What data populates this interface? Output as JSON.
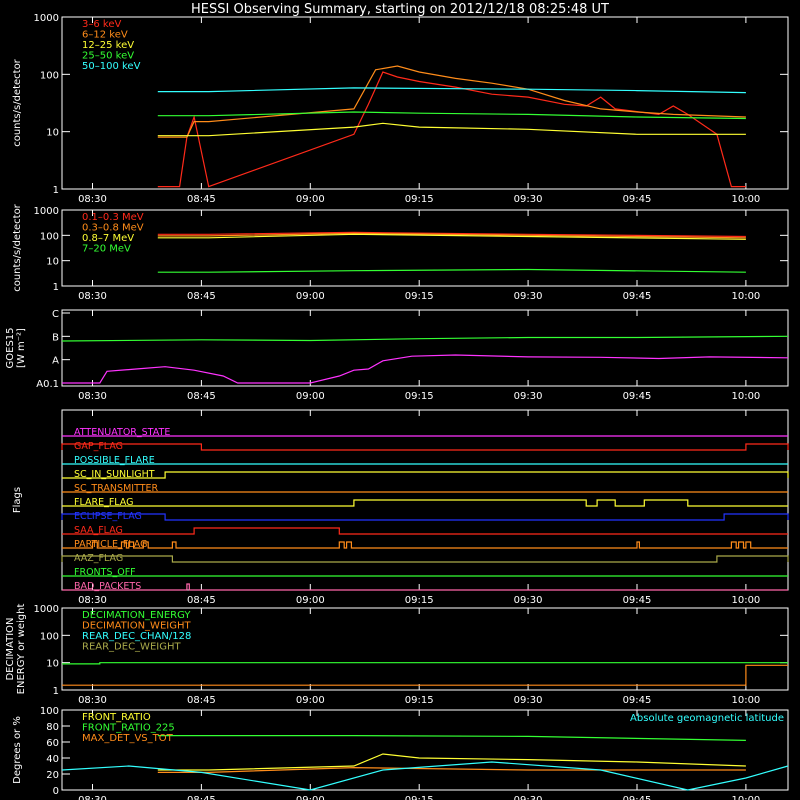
{
  "title": "HESSI Observing Summary, starting on 2012/12/18 08:25:48 UT",
  "colors": {
    "background": "#000000",
    "axes": "#ffffff",
    "red": "#ff2a1a",
    "orange": "#ff8c1a",
    "yellow": "#ffff33",
    "green": "#33ff33",
    "cyan": "#33ffff",
    "magenta": "#ff33ff",
    "blue": "#2233ff",
    "olive": "#a9a94a",
    "pink": "#ff66aa"
  },
  "time_axis": {
    "start": "08:25:48",
    "end": "10:05:48",
    "ticks": [
      "08:30",
      "08:45",
      "09:00",
      "09:15",
      "09:30",
      "09:45",
      "10:00"
    ]
  },
  "chart_data": [
    {
      "type": "line",
      "id": "hxr",
      "ylabel": "counts/s/detector",
      "yscale": "log",
      "ylim": [
        1,
        1000
      ],
      "yticks": [
        "1",
        "10",
        "100",
        "1000"
      ],
      "legend_position": "top-left",
      "series": [
        {
          "name": "3–6 keV",
          "color": "red",
          "points": [
            [
              "08:39:00",
              1.1
            ],
            [
              "08:42:00",
              1.1
            ],
            [
              "08:43:00",
              8
            ],
            [
              "08:44:00",
              18
            ],
            [
              "08:46:00",
              1.1
            ],
            [
              "09:06:00",
              9
            ],
            [
              "09:08:00",
              30
            ],
            [
              "09:10:00",
              110
            ],
            [
              "09:12:00",
              90
            ],
            [
              "09:15:00",
              75
            ],
            [
              "09:20:00",
              60
            ],
            [
              "09:25:00",
              45
            ],
            [
              "09:30:00",
              40
            ],
            [
              "09:35:00",
              30
            ],
            [
              "09:38:00",
              28
            ],
            [
              "09:40:00",
              40
            ],
            [
              "09:42:00",
              25
            ],
            [
              "09:48:00",
              20
            ],
            [
              "09:50:00",
              28
            ],
            [
              "09:52:00",
              20
            ],
            [
              "09:56:00",
              9
            ],
            [
              "09:58:00",
              1.1
            ],
            [
              "10:00:00",
              1.1
            ]
          ]
        },
        {
          "name": "6–12 keV",
          "color": "orange",
          "points": [
            [
              "08:39:00",
              8
            ],
            [
              "08:43:00",
              8
            ],
            [
              "08:44:00",
              15
            ],
            [
              "08:46:00",
              15
            ],
            [
              "09:06:00",
              25
            ],
            [
              "09:09:00",
              120
            ],
            [
              "09:12:00",
              140
            ],
            [
              "09:15:00",
              110
            ],
            [
              "09:20:00",
              85
            ],
            [
              "09:25:00",
              70
            ],
            [
              "09:30:00",
              55
            ],
            [
              "09:35:00",
              35
            ],
            [
              "09:40:00",
              25
            ],
            [
              "09:45:00",
              22
            ],
            [
              "09:50:00",
              20
            ],
            [
              "10:00:00",
              18
            ]
          ]
        },
        {
          "name": "12–25 keV",
          "color": "yellow",
          "points": [
            [
              "08:39:00",
              8.5
            ],
            [
              "08:46:00",
              8.5
            ],
            [
              "09:06:00",
              12
            ],
            [
              "09:10:00",
              14
            ],
            [
              "09:15:00",
              12
            ],
            [
              "09:30:00",
              11
            ],
            [
              "09:45:00",
              9
            ],
            [
              "10:00:00",
              9
            ]
          ]
        },
        {
          "name": "25–50 keV",
          "color": "green",
          "points": [
            [
              "08:39:00",
              19
            ],
            [
              "08:46:00",
              19
            ],
            [
              "09:06:00",
              22
            ],
            [
              "09:15:00",
              21
            ],
            [
              "09:30:00",
              20
            ],
            [
              "09:45:00",
              18
            ],
            [
              "10:00:00",
              17
            ]
          ]
        },
        {
          "name": "50–100 keV",
          "color": "cyan",
          "points": [
            [
              "08:39:00",
              50
            ],
            [
              "08:46:00",
              50
            ],
            [
              "09:06:00",
              58
            ],
            [
              "09:30:00",
              55
            ],
            [
              "09:45:00",
              52
            ],
            [
              "10:00:00",
              48
            ]
          ]
        }
      ]
    },
    {
      "type": "line",
      "id": "gamma",
      "ylabel": "counts/s/detector",
      "yscale": "log",
      "ylim": [
        1,
        1000
      ],
      "yticks": [
        "1",
        "10",
        "100",
        "1000"
      ],
      "legend_position": "top-left",
      "series": [
        {
          "name": "0.1–0.3 MeV",
          "color": "red",
          "points": [
            [
              "08:39:00",
              110
            ],
            [
              "08:46:00",
              110
            ],
            [
              "09:06:00",
              130
            ],
            [
              "09:30:00",
              110
            ],
            [
              "10:00:00",
              90
            ]
          ]
        },
        {
          "name": "0.3–0.8 MeV",
          "color": "orange",
          "points": [
            [
              "08:39:00",
              95
            ],
            [
              "08:46:00",
              95
            ],
            [
              "09:06:00",
              120
            ],
            [
              "09:30:00",
              100
            ],
            [
              "10:00:00",
              80
            ]
          ]
        },
        {
          "name": "0.8–7 MeV",
          "color": "yellow",
          "points": [
            [
              "08:39:00",
              80
            ],
            [
              "08:46:00",
              80
            ],
            [
              "09:06:00",
              110
            ],
            [
              "09:30:00",
              90
            ],
            [
              "10:00:00",
              70
            ]
          ]
        },
        {
          "name": "7–20 MeV",
          "color": "green",
          "points": [
            [
              "08:39:00",
              3.5
            ],
            [
              "08:46:00",
              3.5
            ],
            [
              "09:06:00",
              4
            ],
            [
              "09:30:00",
              4.5
            ],
            [
              "10:00:00",
              3.5
            ]
          ]
        }
      ]
    },
    {
      "type": "line",
      "id": "goes",
      "ylabel": "GOES15",
      "ylabel2": "[W m⁻²]",
      "yticks": [
        "A0.1",
        "A",
        "B",
        "C"
      ],
      "series": [
        {
          "name": "goes-long",
          "color": "green",
          "points": [
            [
              "08:25:48",
              1.8
            ],
            [
              "08:45:00",
              1.85
            ],
            [
              "09:00:00",
              1.82
            ],
            [
              "09:15:00",
              1.9
            ],
            [
              "09:30:00",
              1.95
            ],
            [
              "09:45:00",
              1.95
            ],
            [
              "10:05:48",
              2.0
            ]
          ]
        },
        {
          "name": "goes-short",
          "color": "magenta",
          "points": [
            [
              "08:25:48",
              0.0
            ],
            [
              "08:31:00",
              0.0
            ],
            [
              "08:32:00",
              0.5
            ],
            [
              "08:36:00",
              0.6
            ],
            [
              "08:40:00",
              0.7
            ],
            [
              "08:44:00",
              0.55
            ],
            [
              "08:48:00",
              0.3
            ],
            [
              "08:50:00",
              0.0
            ],
            [
              "09:00:00",
              0.0
            ],
            [
              "09:04:00",
              0.3
            ],
            [
              "09:06:00",
              0.55
            ],
            [
              "09:08:00",
              0.6
            ],
            [
              "09:10:00",
              0.95
            ],
            [
              "09:14:00",
              1.15
            ],
            [
              "09:20:00",
              1.2
            ],
            [
              "09:30:00",
              1.12
            ],
            [
              "09:40:00",
              1.1
            ],
            [
              "09:48:00",
              1.05
            ],
            [
              "09:55:00",
              1.12
            ],
            [
              "10:05:48",
              1.08
            ]
          ]
        }
      ]
    },
    {
      "type": "step",
      "id": "flags",
      "ylabel": "Flags",
      "rows": [
        {
          "name": "ATTENUATOR_STATE",
          "color": "magenta",
          "on": []
        },
        {
          "name": "GAP_FLAG",
          "color": "red",
          "on": [
            [
              "08:25:48",
              "08:45:00"
            ],
            [
              "10:00:00",
              "10:05:48"
            ]
          ]
        },
        {
          "name": "POSSIBLE_FLARE",
          "color": "cyan",
          "on": []
        },
        {
          "name": "SC_IN_SUNLIGHT",
          "color": "yellow",
          "on": [
            [
              "08:40:00",
              "10:05:48"
            ]
          ]
        },
        {
          "name": "SC_TRANSMITTER",
          "color": "orange",
          "on": []
        },
        {
          "name": "FLARE_FLAG",
          "color": "yellow",
          "on": [
            [
              "09:06:00",
              "09:38:00"
            ],
            [
              "09:39:30",
              "09:42:00"
            ],
            [
              "09:46:00",
              "09:52:00"
            ]
          ]
        },
        {
          "name": "ECLIPSE_FLAG",
          "color": "blue",
          "on": [
            [
              "08:25:48",
              "08:40:00"
            ],
            [
              "09:57:00",
              "10:05:48"
            ]
          ]
        },
        {
          "name": "SAA_FLAG",
          "color": "red",
          "on": [
            [
              "08:44:00",
              "09:04:00"
            ]
          ]
        },
        {
          "name": "PARTICLE_FLAG",
          "color": "orange",
          "on": [
            [
              "08:30:00",
              "08:30:40"
            ],
            [
              "08:34:00",
              "08:34:40"
            ],
            [
              "08:35:00",
              "08:35:40"
            ],
            [
              "08:37:00",
              "08:37:40"
            ],
            [
              "08:41:00",
              "08:41:30"
            ],
            [
              "09:04:00",
              "09:04:40"
            ],
            [
              "09:05:00",
              "09:05:40"
            ],
            [
              "09:45:00",
              "09:45:20"
            ],
            [
              "09:58:00",
              "09:58:40"
            ],
            [
              "09:59:00",
              "09:59:40"
            ],
            [
              "10:00:00",
              "10:00:40"
            ]
          ]
        },
        {
          "name": "AAZ_FLAG",
          "color": "olive",
          "on": [
            [
              "08:25:48",
              "08:41:00"
            ],
            [
              "09:56:00",
              "10:05:48"
            ]
          ]
        },
        {
          "name": "FRONTS_OFF",
          "color": "green",
          "on": []
        },
        {
          "name": "BAD_PACKETS",
          "color": "pink",
          "on": [
            [
              "08:43:00",
              "08:43:20"
            ]
          ]
        }
      ]
    },
    {
      "type": "line",
      "id": "decimation",
      "ylabel": "DECIMATION",
      "ylabel2": "ENERGY or weight",
      "yscale": "log",
      "ylim": [
        1,
        1000
      ],
      "yticks": [
        "1",
        "10",
        "100",
        "1000"
      ],
      "series": [
        {
          "name": "DECIMATION_ENERGY",
          "color": "green",
          "points": [
            [
              "08:25:48",
              9
            ],
            [
              "08:31:00",
              9
            ],
            [
              "08:31:00",
              10
            ],
            [
              "10:00:00",
              10
            ],
            [
              "10:05:48",
              10
            ]
          ]
        },
        {
          "name": "DECIMATION_WEIGHT",
          "color": "orange",
          "points": [
            [
              "08:25:48",
              1.5
            ],
            [
              "10:00:00",
              1.5
            ],
            [
              "10:00:00",
              8
            ],
            [
              "10:05:48",
              8
            ]
          ]
        },
        {
          "name": "REAR_DEC_CHAN/128",
          "color": "cyan",
          "points": []
        },
        {
          "name": "REAR_DEC_WEIGHT",
          "color": "olive",
          "points": []
        }
      ]
    },
    {
      "type": "line",
      "id": "ratios",
      "ylabel": "Degrees or %",
      "ylim": [
        0,
        100
      ],
      "yticks": [
        "0",
        "20",
        "40",
        "60",
        "80",
        "100"
      ],
      "right_note": "Absolute geomagnetic latitude",
      "series": [
        {
          "name": "FRONT_RATIO",
          "color": "yellow",
          "points": [
            [
              "08:39:00",
              25
            ],
            [
              "08:46:00",
              25
            ],
            [
              "09:06:00",
              30
            ],
            [
              "09:10:00",
              45
            ],
            [
              "09:15:00",
              40
            ],
            [
              "09:30:00",
              38
            ],
            [
              "09:45:00",
              35
            ],
            [
              "10:00:00",
              30
            ]
          ]
        },
        {
          "name": "FRONT_RATIO_225",
          "color": "green",
          "points": [
            [
              "08:39:00",
              68
            ],
            [
              "08:46:00",
              68
            ],
            [
              "09:06:00",
              68
            ],
            [
              "09:30:00",
              67
            ],
            [
              "10:00:00",
              62
            ]
          ]
        },
        {
          "name": "MAX_DET_VS_TOT",
          "color": "orange",
          "points": [
            [
              "08:39:00",
              22
            ],
            [
              "08:46:00",
              22
            ],
            [
              "09:06:00",
              28
            ],
            [
              "09:30:00",
              25
            ],
            [
              "10:00:00",
              25
            ]
          ]
        },
        {
          "name": "geomagnetic-latitude",
          "color": "cyan",
          "points": [
            [
              "08:25:48",
              25
            ],
            [
              "08:35:00",
              30
            ],
            [
              "08:45:00",
              22
            ],
            [
              "09:00:00",
              0
            ],
            [
              "09:10:00",
              25
            ],
            [
              "09:25:00",
              35
            ],
            [
              "09:40:00",
              25
            ],
            [
              "09:52:00",
              0
            ],
            [
              "10:00:00",
              15
            ],
            [
              "10:05:48",
              30
            ]
          ]
        }
      ]
    }
  ]
}
